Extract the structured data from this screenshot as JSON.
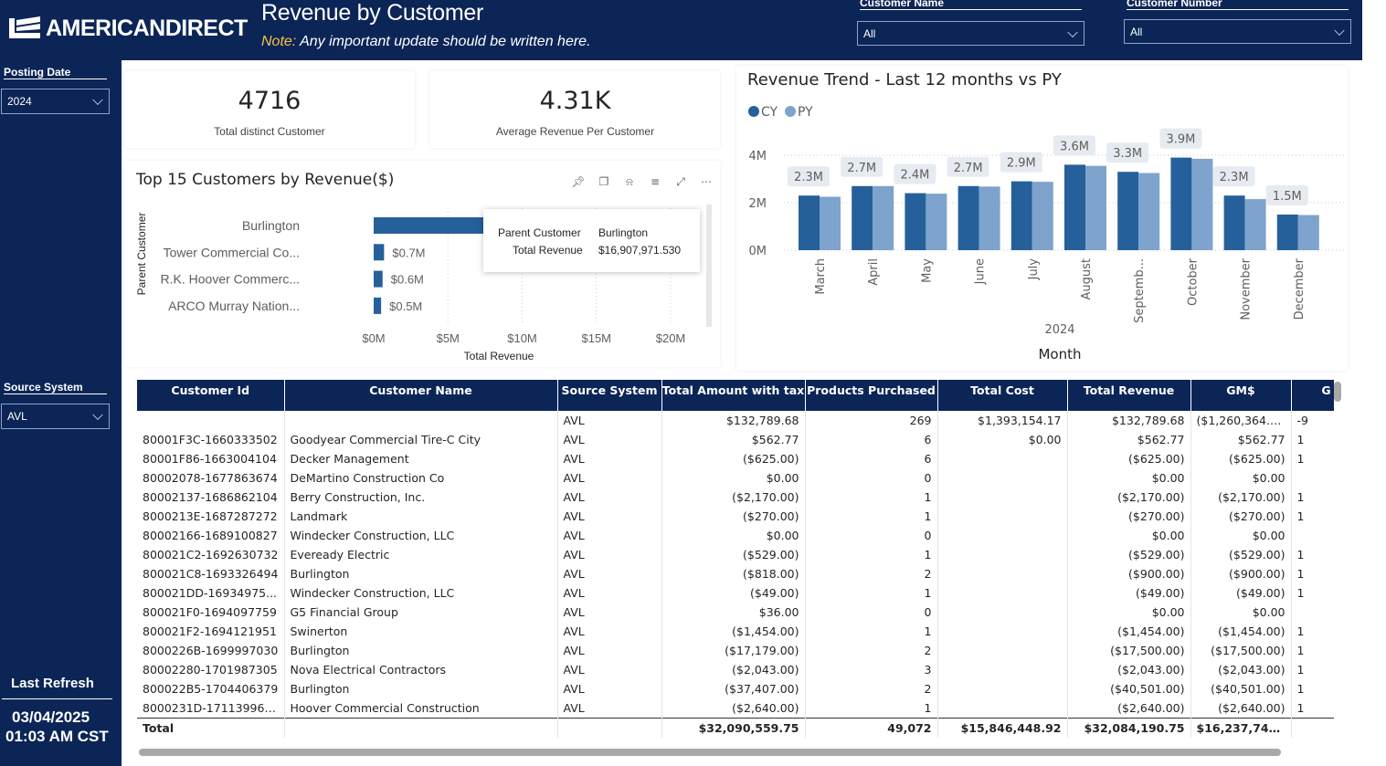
{
  "header": {
    "brand": "AMERICANDIRECT",
    "title": "Revenue by Customer",
    "note_label": "Note:",
    "note_text": " Any important update should be written here.",
    "customer_name_label": "Customer Name",
    "customer_name_value": "All",
    "customer_number_label": "Customer Number",
    "customer_number_value": "All"
  },
  "sidebar": {
    "posting_date_label": "Posting Date",
    "posting_date_value": "2024",
    "source_system_label": "Source System",
    "source_system_value": "AVL",
    "last_refresh_label": "Last Refresh",
    "last_refresh_date": "03/04/2025",
    "last_refresh_time": "01:03 AM CST"
  },
  "kpis": [
    {
      "value": "4716",
      "label": "Total distinct Customer"
    },
    {
      "value": "4.31K",
      "label": "Average Revenue Per Customer"
    }
  ],
  "colors": {
    "navy": "#0c2557",
    "cy": "#25609b",
    "py": "#7ea3cc"
  },
  "top_customers": {
    "title": "Top 15 Customers by Revenue($)",
    "y_axis_label": "Parent Customer",
    "x_axis_label": "Total Revenue",
    "x_ticks": [
      "$0M",
      "$5M",
      "$10M",
      "$15M",
      "$20M"
    ],
    "tooltip": {
      "key1": "Parent Customer",
      "val1": "Burlington",
      "key2": "Total Revenue",
      "val2": "$16,907,971.530"
    }
  },
  "trend": {
    "title": "Revenue Trend - Last 12 months vs PY",
    "legend": [
      "CY",
      "PY"
    ],
    "year_label": "2024",
    "x_axis_title": "Month"
  },
  "chart_data": [
    {
      "type": "bar",
      "orientation": "horizontal",
      "title": "Top 15 Customers by Revenue($)",
      "ylabel": "Parent Customer",
      "xlabel": "Total Revenue",
      "xlim": [
        0,
        22000000
      ],
      "categories": [
        "Burlington",
        "Tower Commercial Co...",
        "R.K. Hoover Commerc...",
        "ARCO Murray Nation..."
      ],
      "values": [
        16907971.53,
        700000,
        600000,
        500000
      ],
      "data_labels": [
        "",
        "$0.7M",
        "$0.6M",
        "$0.5M"
      ]
    },
    {
      "type": "bar",
      "title": "Revenue Trend - Last 12 months vs PY",
      "xlabel": "Month",
      "ylim": [
        0,
        4000000
      ],
      "y_ticks": [
        "0M",
        "2M",
        "4M"
      ],
      "categories": [
        "March",
        "April",
        "May",
        "June",
        "July",
        "August",
        "Septemb...",
        "October",
        "November",
        "December"
      ],
      "series": [
        {
          "name": "CY",
          "values": [
            2300000,
            2700000,
            2400000,
            2700000,
            2900000,
            3600000,
            3300000,
            3900000,
            2300000,
            1500000
          ]
        },
        {
          "name": "PY",
          "values": [
            2250000,
            2700000,
            2380000,
            2680000,
            2880000,
            3550000,
            3250000,
            3850000,
            2150000,
            1480000
          ]
        }
      ],
      "data_labels": [
        "2.3M",
        "2.7M",
        "2.4M",
        "2.7M",
        "2.9M",
        "3.6M",
        "3.3M",
        "3.9M",
        "2.3M",
        "1.5M"
      ]
    }
  ],
  "table": {
    "columns": [
      "Customer Id",
      "Customer Name",
      "Source System",
      "Total Amount with tax",
      "Products Purchased",
      "Total Cost",
      "Total Revenue",
      "GM$",
      "G"
    ],
    "rows": [
      [
        "",
        "",
        "AVL",
        "$132,789.68",
        "269",
        "$1,393,154.17",
        "$132,789.68",
        "($1,260,364.49)",
        "-9"
      ],
      [
        "80001F3C-1660333502",
        "Goodyear Commercial Tire-C City",
        "AVL",
        "$562.77",
        "6",
        "$0.00",
        "$562.77",
        "$562.77",
        "1"
      ],
      [
        "80001F86-1663004104",
        "Decker Management",
        "AVL",
        "($625.00)",
        "6",
        "",
        "($625.00)",
        "($625.00)",
        "1"
      ],
      [
        "80002078-1677863674",
        "DeMartino Construction Co",
        "AVL",
        "$0.00",
        "0",
        "",
        "$0.00",
        "$0.00",
        ""
      ],
      [
        "80002137-1686862104",
        "Berry Construction, Inc.",
        "AVL",
        "($2,170.00)",
        "1",
        "",
        "($2,170.00)",
        "($2,170.00)",
        "1"
      ],
      [
        "8000213E-1687287272",
        "Landmark",
        "AVL",
        "($270.00)",
        "1",
        "",
        "($270.00)",
        "($270.00)",
        "1"
      ],
      [
        "80002166-1689100827",
        "Windecker Construction, LLC",
        "AVL",
        "$0.00",
        "0",
        "",
        "$0.00",
        "$0.00",
        ""
      ],
      [
        "800021C2-1692630732",
        "Eveready Electric",
        "AVL",
        "($529.00)",
        "1",
        "",
        "($529.00)",
        "($529.00)",
        "1"
      ],
      [
        "800021C8-1693326494",
        "Burlington",
        "AVL",
        "($818.00)",
        "2",
        "",
        "($900.00)",
        "($900.00)",
        "1"
      ],
      [
        "800021DD-16934975...",
        "Windecker Construction, LLC",
        "AVL",
        "($49.00)",
        "1",
        "",
        "($49.00)",
        "($49.00)",
        "1"
      ],
      [
        "800021F0-1694097759",
        "G5 Financial Group",
        "AVL",
        "$36.00",
        "0",
        "",
        "$0.00",
        "$0.00",
        ""
      ],
      [
        "800021F2-1694121951",
        "Swinerton",
        "AVL",
        "($1,454.00)",
        "1",
        "",
        "($1,454.00)",
        "($1,454.00)",
        "1"
      ],
      [
        "8000226B-1699997030",
        "Burlington",
        "AVL",
        "($17,179.00)",
        "2",
        "",
        "($17,500.00)",
        "($17,500.00)",
        "1"
      ],
      [
        "80002280-1701987305",
        "Nova Electrical Contractors",
        "AVL",
        "($2,043.00)",
        "3",
        "",
        "($2,043.00)",
        "($2,043.00)",
        "1"
      ],
      [
        "800022B5-1704406379",
        "Burlington",
        "AVL",
        "($37,407.00)",
        "2",
        "",
        "($40,501.00)",
        "($40,501.00)",
        "1"
      ],
      [
        "8000231D-1711399674",
        "Hoover Commercial Construction",
        "AVL",
        "($2,640.00)",
        "1",
        "",
        "($2,640.00)",
        "($2,640.00)",
        "1"
      ]
    ],
    "total": [
      "Total",
      "",
      "",
      "$32,090,559.75",
      "49,072",
      "$15,846,448.92",
      "$32,084,190.75",
      "$16,237,741.83",
      ""
    ]
  }
}
